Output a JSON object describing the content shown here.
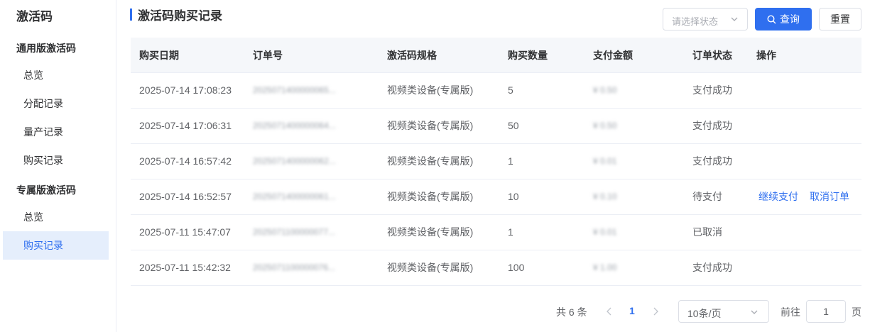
{
  "sidebar": {
    "title": "激活码",
    "groups": [
      {
        "label": "通用版激活码",
        "items": [
          {
            "label": "总览"
          },
          {
            "label": "分配记录"
          },
          {
            "label": "量产记录"
          },
          {
            "label": "购买记录"
          }
        ]
      },
      {
        "label": "专属版激活码",
        "items": [
          {
            "label": "总览"
          },
          {
            "label": "购买记录"
          }
        ]
      }
    ],
    "active_item": "专属版激活码/购买记录"
  },
  "header": {
    "title": "激活码购买记录",
    "status_select_placeholder": "请选择状态",
    "query_button": "查询",
    "reset_button": "重置"
  },
  "table": {
    "columns": [
      "购买日期",
      "订单号",
      "激活码规格",
      "购买数量",
      "支付金额",
      "订单状态",
      "操作"
    ],
    "rows": [
      {
        "date": "2025-07-14 17:08:23",
        "order_no": "2025071400000065...",
        "spec": "视频类设备(专属版)",
        "qty": "5",
        "amount": "¥ 0.50",
        "status": "支付成功",
        "actions": []
      },
      {
        "date": "2025-07-14 17:06:31",
        "order_no": "2025071400000064...",
        "spec": "视频类设备(专属版)",
        "qty": "50",
        "amount": "¥ 0.50",
        "status": "支付成功",
        "actions": []
      },
      {
        "date": "2025-07-14 16:57:42",
        "order_no": "2025071400000062...",
        "spec": "视频类设备(专属版)",
        "qty": "1",
        "amount": "¥ 0.01",
        "status": "支付成功",
        "actions": []
      },
      {
        "date": "2025-07-14 16:52:57",
        "order_no": "2025071400000061...",
        "spec": "视频类设备(专属版)",
        "qty": "10",
        "amount": "¥ 0.10",
        "status": "待支付",
        "actions": [
          "继续支付",
          "取消订单"
        ]
      },
      {
        "date": "2025-07-11 15:47:07",
        "order_no": "2025071100000077...",
        "spec": "视频类设备(专属版)",
        "qty": "1",
        "amount": "¥ 0.01",
        "status": "已取消",
        "actions": []
      },
      {
        "date": "2025-07-11 15:42:32",
        "order_no": "2025071100000076...",
        "spec": "视频类设备(专属版)",
        "qty": "100",
        "amount": "¥ 1.00",
        "status": "支付成功",
        "actions": []
      }
    ]
  },
  "pagination": {
    "total_text": "共 6 条",
    "current_page": "1",
    "page_size": "10条/页",
    "goto_label": "前往",
    "goto_value": "1",
    "goto_suffix": "页"
  },
  "colors": {
    "accent": "#2f6fef",
    "active_bg": "#e5eefc",
    "header_bg": "#f5f7fa",
    "border": "#ebeef5"
  },
  "icons": [
    "search-icon",
    "chevron-down-icon",
    "chevron-left-icon",
    "chevron-right-icon"
  ]
}
